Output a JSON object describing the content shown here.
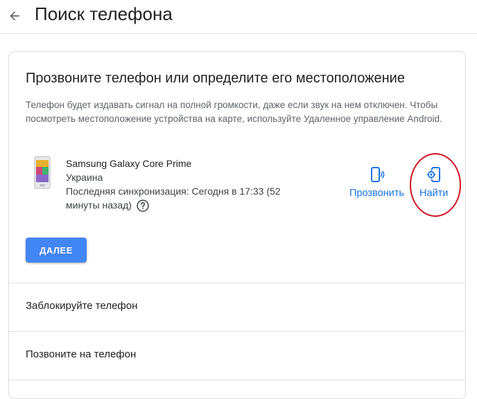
{
  "header": {
    "back_icon": "arrow-back-icon",
    "title": "Поиск телефона"
  },
  "card": {
    "heading": "Прозвоните телефон или определите его местоположение",
    "description": "Телефон будет издавать сигнал на полной громкости, даже если звук на нем отключен. Чтобы посмотреть местоположение устройства на карте, используйте Удаленное управление Android.",
    "device": {
      "image_icon": "phone-thumbnail-icon",
      "name": "Samsung Galaxy Core Prime",
      "country": "Украина",
      "last_sync": "Последняя синхронизация: Сегодня в 17:33 (52 минуты назад)",
      "help_icon": "help-circle-icon"
    },
    "actions": {
      "ring": {
        "label": "Прозвонить",
        "icon": "phone-ring-icon"
      },
      "find": {
        "label": "Найти",
        "icon": "phone-locate-icon"
      }
    },
    "next_button": "ДАЛЕЕ",
    "list": [
      {
        "label": "Заблокируйте телефон"
      },
      {
        "label": "Позвоните на телефон"
      }
    ]
  },
  "colors": {
    "accent": "#1a73e8",
    "button": "#4285f4",
    "highlight_ring": "#d01220",
    "divider": "#e0e0e0"
  }
}
